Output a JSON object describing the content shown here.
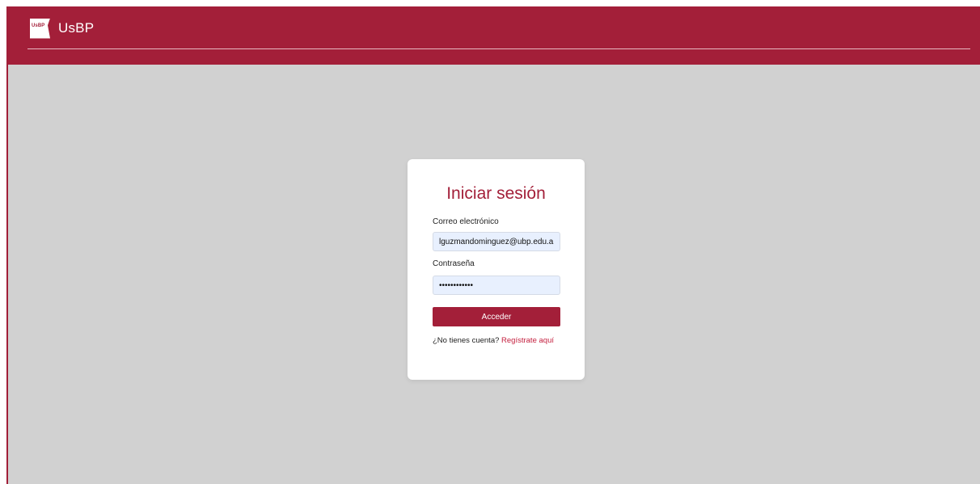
{
  "header": {
    "logo_text": "UsBP",
    "brand_name": "UsBP",
    "accent_color": "#a31f39",
    "background_color": "#d1d1d1"
  },
  "login": {
    "title": "Iniciar sesión",
    "email_label": "Correo electrónico",
    "email_value": "lguzmandominguez@ubp.edu.a",
    "password_label": "Contraseña",
    "password_value": "••••••••••••",
    "submit_label": "Acceder",
    "signup_prompt": "¿No tienes cuenta?",
    "signup_link": "Regístrate aquí"
  }
}
